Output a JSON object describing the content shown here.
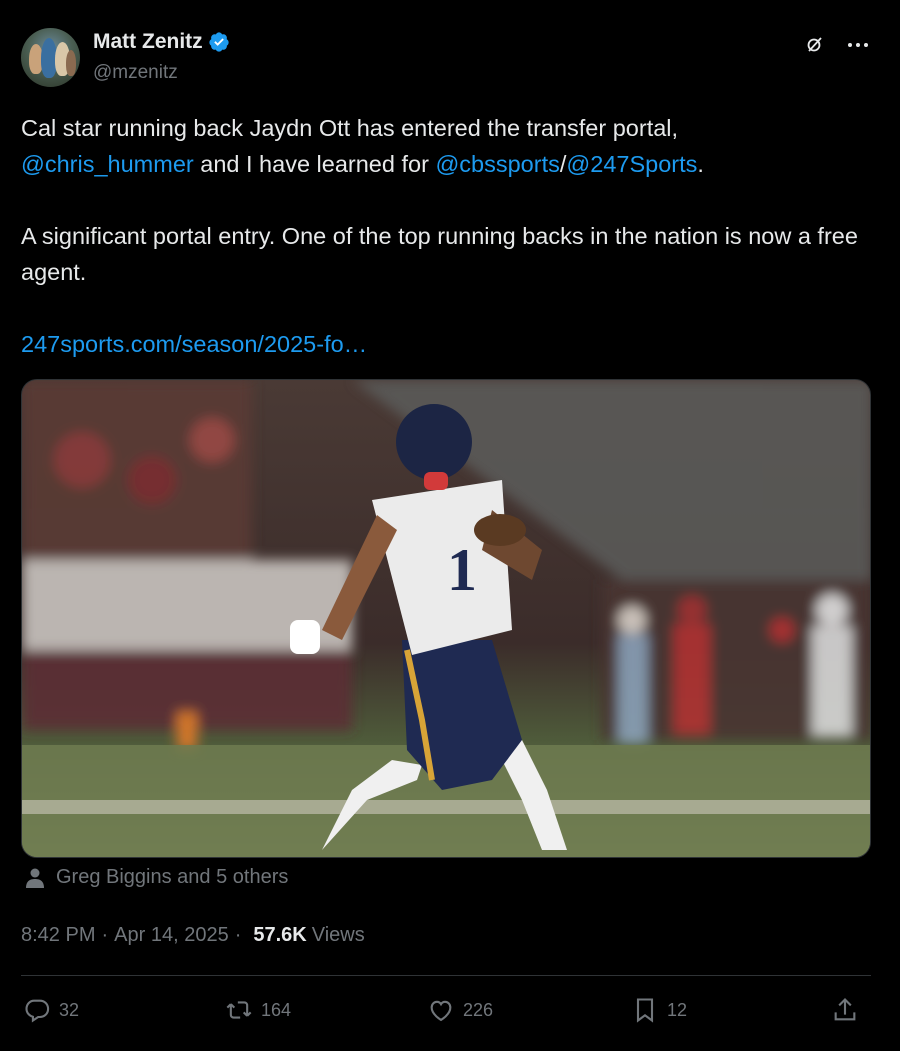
{
  "author": {
    "name": "Matt Zenitz",
    "handle": "@mzenitz",
    "verified_color": "#1d9bf0"
  },
  "tweet": {
    "line1": "Cal star running back Jaydn Ott has entered the transfer portal,",
    "mention_1": "@chris_hummer",
    "mid_text": " and I have learned for ",
    "mention_2": "@cbssports",
    "slash": "/",
    "mention_3": "@247Sports",
    "period": ".",
    "para2": "A significant portal entry. One of the top running backs in the nation is now a free agent.",
    "link": "247sports.com/season/2025-fo…"
  },
  "tagged": "Greg Biggins and 5 others",
  "meta": {
    "time": "8:42 PM",
    "dot1": "·",
    "date": "Apr 14, 2025",
    "dot2": "·",
    "views_count": "57.6K",
    "views_label": "Views"
  },
  "actions": {
    "replies": "32",
    "reposts": "164",
    "likes": "226",
    "bookmarks": "12"
  },
  "colors": {
    "background": "#000000",
    "text": "#e7e9ea",
    "muted": "#71767b",
    "link": "#1d9bf0",
    "divider": "#2f3336"
  },
  "icons": [
    "verified-badge-icon",
    "grok-icon",
    "more-icon",
    "person-icon",
    "reply-icon",
    "repost-icon",
    "like-icon",
    "bookmark-icon",
    "share-icon"
  ]
}
